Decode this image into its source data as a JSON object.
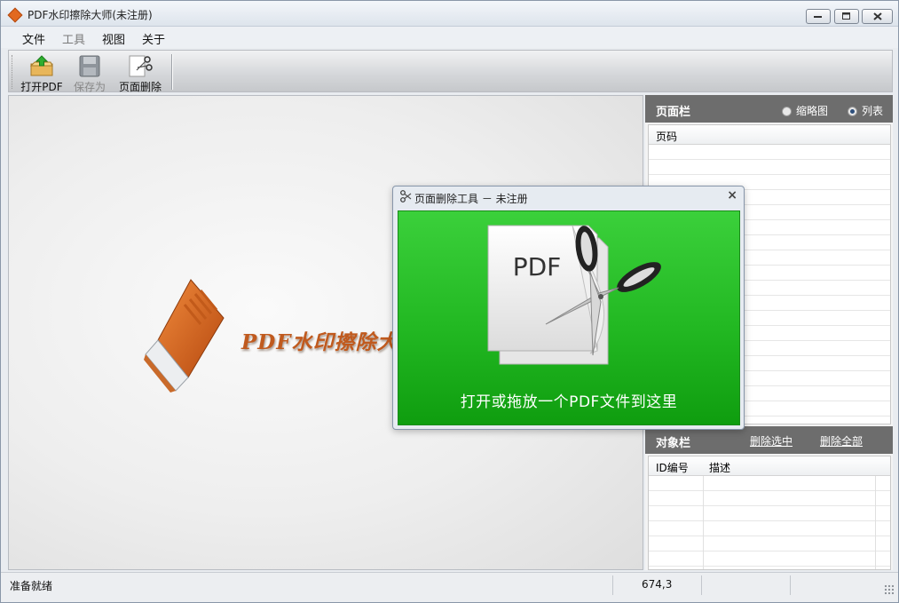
{
  "window": {
    "title": "PDF水印擦除大师(未注册)"
  },
  "menu": {
    "items": [
      "文件",
      "工具",
      "视图",
      "关于"
    ]
  },
  "toolbar": {
    "open_label": "打开PDF",
    "save_as_label": "保存为",
    "page_delete_label": "页面删除"
  },
  "workspace": {
    "logo_text": "PDF水印擦除大师"
  },
  "pages_panel": {
    "title": "页面栏",
    "view_thumbnail": "缩略图",
    "view_list": "列表",
    "selected_view": "列表",
    "column_page": "页码"
  },
  "objects_panel": {
    "title": "对象栏",
    "delete_selected": "删除选中",
    "delete_all": "删除全部",
    "column_id": "ID编号",
    "column_desc": "描述"
  },
  "dialog": {
    "title": "页面删除工具 － 未注册",
    "close_glyph": "×",
    "art_text": "PDF",
    "drop_text": "打开或拖放一个PDF文件到这里"
  },
  "status": {
    "text": "准备就绪",
    "coords": "674,3"
  },
  "colors": {
    "accent_orange": "#e2691f",
    "drop_green": "#22b822",
    "panel_header": "#6d6d6d"
  }
}
